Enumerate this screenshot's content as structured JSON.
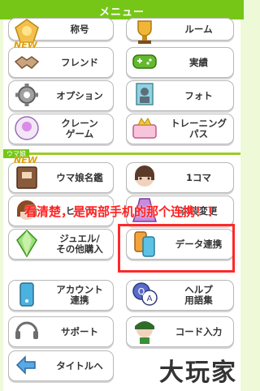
{
  "header": {
    "title": "メニュー"
  },
  "menu": {
    "title_label": "称号",
    "room_label": "ルーム",
    "new_badge": "NEW",
    "friend_label": "フレンド",
    "achievement_label": "実績",
    "options_label": "オプション",
    "photo_label": "フォト",
    "crane_label": "クレーン\nゲーム",
    "training_pass_label": "トレーニング\nパス",
    "uma_section": "ウマ娘",
    "uma_new_badge": "NEW",
    "uma_guide_label": "ウマ娘名鑑",
    "koma_label": "1コマ",
    "secret_label": "ヒミツ",
    "costume_label": "衣装変更",
    "jewel_label": "ジュエル/\nその他購入",
    "data_link_label": "データ連携",
    "account_label": "アカウント\n連携",
    "help_label": "ヘルプ\n用語集",
    "support_label": "サポート",
    "code_label": "コード入力",
    "title_screen_label": "タイトルへ"
  },
  "annotation": {
    "text": "看清楚，是两部手机的那个连携！！"
  },
  "watermark": {
    "text": "大玩家"
  }
}
